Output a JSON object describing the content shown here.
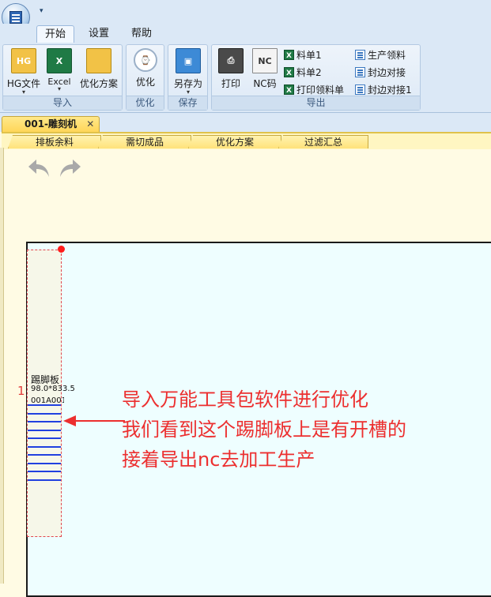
{
  "titlebar": {
    "qat_arrow": "▾"
  },
  "ribbon_tabs": [
    {
      "label": "开始",
      "active": true
    },
    {
      "label": "设置",
      "active": false
    },
    {
      "label": "帮助",
      "active": false
    }
  ],
  "groups": {
    "import": {
      "label": "导入",
      "hg_file": "HG文件",
      "excel": "Excel",
      "opt_plan": "优化方案",
      "hg_icon_text": "HG",
      "excel_icon_text": "X"
    },
    "optimize": {
      "label": "优化",
      "optimize_btn": "优化"
    },
    "save": {
      "label": "保存",
      "save_as": "另存为"
    },
    "export": {
      "label": "导出",
      "print": "打印",
      "nc_code": "NC码",
      "nc_icon_text": "NC",
      "list1": "料单1",
      "list2": "料单2",
      "print_pick_list": "打印领料单",
      "production_pick": "生产领料",
      "edge_joint": "封边对接",
      "edge_joint1": "封边对接1"
    }
  },
  "doc_tab": {
    "title": "001-雕刻机",
    "close": "✕"
  },
  "sub_tabs": [
    "排板余料",
    "需切成品",
    "优化方案",
    "过滤汇总"
  ],
  "part": {
    "index": "1",
    "name": "踢脚板",
    "size": "98.0*833.5",
    "code": "001A001",
    "slot_count": 10
  },
  "annotation": {
    "lines": [
      "导入万能工具包软件进行优化",
      "我们看到这个踢脚板上是有开槽的",
      "接着导出nc去加工生产"
    ]
  },
  "colors": {
    "ribbon_bg": "#dbe8f6",
    "workspace_bg": "#fffbe4",
    "board_bg": "#eefeff",
    "annotation": "#ec2f2f",
    "slot": "#2040e0",
    "pin": "#ff1b1b"
  }
}
